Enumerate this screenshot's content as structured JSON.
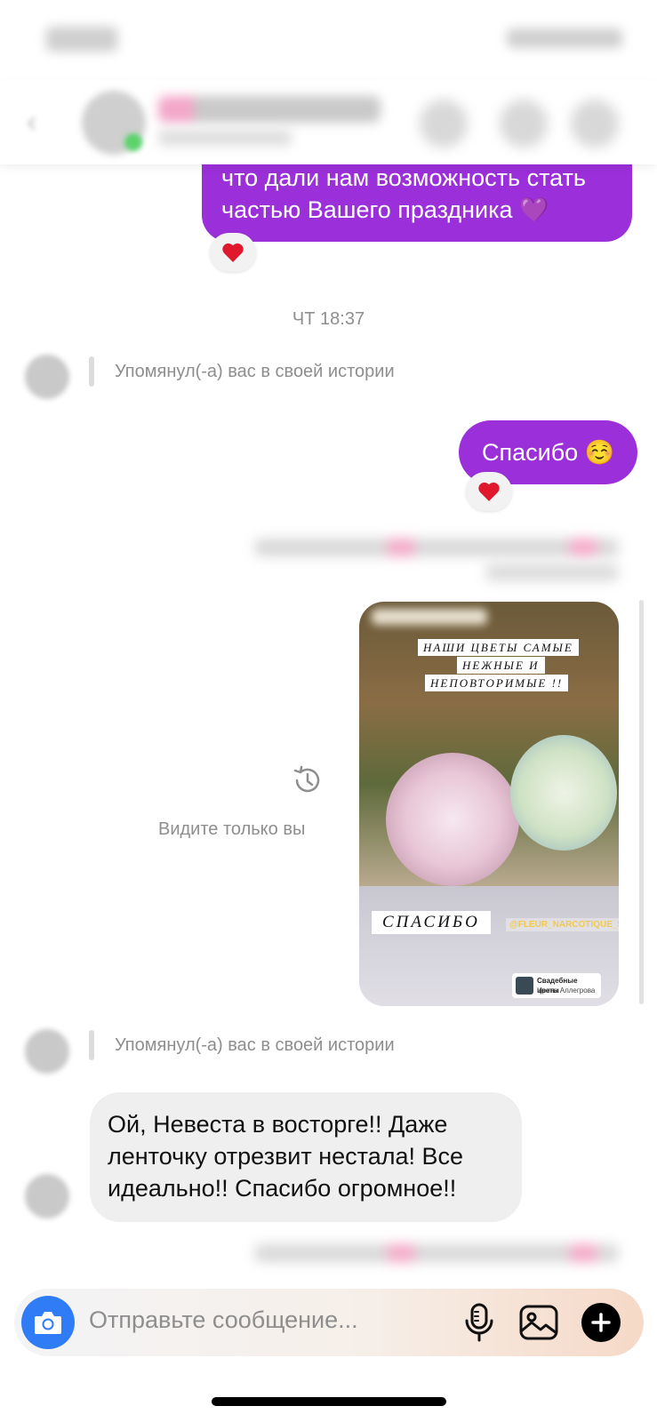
{
  "status_bar": {
    "time_icon": "blurred-time",
    "indicators_icon": "blurred-status-icons"
  },
  "header": {
    "back_icon": "chevron-left-icon",
    "avatar_icon": "profile-avatar",
    "actions": [
      "phone-icon",
      "video-icon",
      "info-icon"
    ]
  },
  "messages": {
    "first_out": "что дали нам возможность стать частью Вашего праздника 💜",
    "reaction_1": "heart-reaction",
    "timestamp": "ЧТ 18:37",
    "mention_1": "Упомянул(-а) вас в своей истории",
    "out_thanks": "Спасибо ☺️",
    "reaction_2": "heart-reaction",
    "only_you": "Видите только вы",
    "mention_2": "Упомянул(-а) вас в своей истории",
    "in_message": "Ой, Невеста в восторге!! Даже ленточку отрезвит нестала! Все идеально!! Спасибо огромное!!"
  },
  "story": {
    "caption_line_1": "НАШИ ЦВЕТЫ САМЫЕ",
    "caption_line_2": "НЕЖНЫЕ И",
    "caption_line_3": "НЕПОВТОРИМЫЕ !!",
    "thanks": "СПАСИБО",
    "tag": "@FLEUR_NARCOTIQUE_SPB",
    "sticker_title": "Свадебные цветы",
    "sticker_sub": "Ирина Аллегрова"
  },
  "composer": {
    "placeholder": "Отправьте сообщение...",
    "camera_icon": "camera-icon",
    "mic_icon": "microphone-icon",
    "gallery_icon": "gallery-icon",
    "plus_icon": "plus-icon"
  },
  "colors": {
    "outgoing": "#9b2fd9",
    "incoming": "#efefef",
    "camera": "#2f7cf6"
  }
}
